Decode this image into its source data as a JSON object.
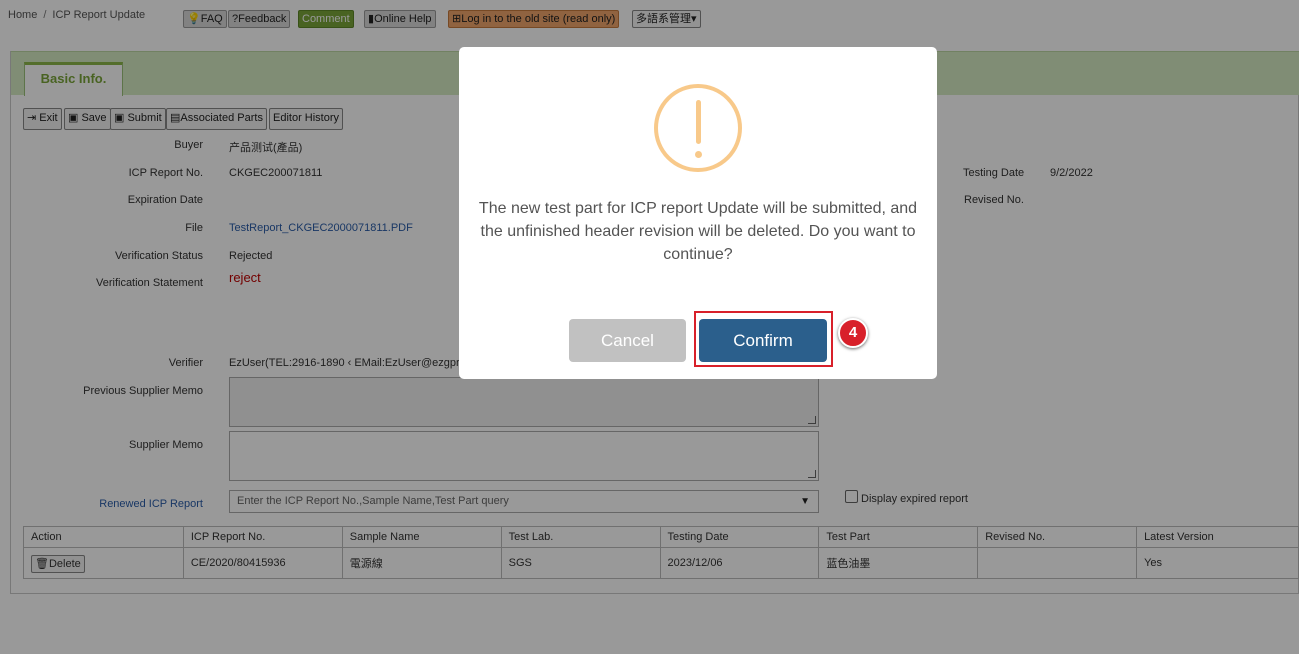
{
  "breadcrumb": {
    "home": "Home",
    "sep": "/",
    "current": "ICP Report Update"
  },
  "toolbar": {
    "faq": "FAQ",
    "feedback": "Feedback",
    "comment": "Comment",
    "online_help": "Online Help",
    "old_site": "Log in to the old site (read only)",
    "language": "多語系管理"
  },
  "tab": {
    "label": "Basic Info."
  },
  "actions": {
    "exit": "Exit",
    "save": "Save",
    "submit": "Submit",
    "associated_parts": "Associated Parts",
    "editor_history": "Editor History"
  },
  "fields": {
    "buyer_label": "Buyer",
    "buyer_value": "产品测试(產品)",
    "icp_no_label": "ICP Report No.",
    "icp_no_value": "CKGEC200071811",
    "testing_date_label": "Testing Date",
    "testing_date_value": "9/2/2022",
    "expiration_label": "Expiration Date",
    "revised_label": "Revised No.",
    "file_label": "File",
    "file_value": "TestReport_CKGEC2000071811.PDF",
    "verification_status_label": "Verification Status",
    "verification_status_value": "Rejected",
    "verification_statement_label": "Verification Statement",
    "verification_statement_value": "reject",
    "verifier_label": "Verifier",
    "verifier_value": "EzUser(TEL:2916-1890 ‹ EMail:EzUser@ezgpr",
    "prev_memo_label": "Previous Supplier Memo",
    "supplier_memo_label": "Supplier Memo",
    "renewed_label": "Renewed ICP Report",
    "renewed_placeholder": "Enter the ICP Report No.,Sample Name,Test Part query",
    "display_expired": "Display expired report"
  },
  "table": {
    "headers": [
      "Action",
      "ICP Report No.",
      "Sample Name",
      "Test Lab.",
      "Testing Date",
      "Test Part",
      "Revised No.",
      "Latest Version"
    ],
    "rows": [
      {
        "action": "Delete",
        "icp_no": "CE/2020/80415936",
        "sample": "電源線",
        "lab": "SGS",
        "date": "2023/12/06",
        "part": "蓝色油墨",
        "revised": "",
        "latest": "Yes"
      }
    ]
  },
  "modal": {
    "message": "The new test part for ICP report Update will be submitted, and the unfinished header revision will be deleted. Do you want to continue?",
    "cancel": "Cancel",
    "confirm": "Confirm"
  },
  "step_badge": "4",
  "colors": {
    "accent_green": "#7aa63a",
    "confirm_blue": "#2b5f8c",
    "highlight_red": "#d8202a",
    "warning_orange": "#f8c98a"
  }
}
